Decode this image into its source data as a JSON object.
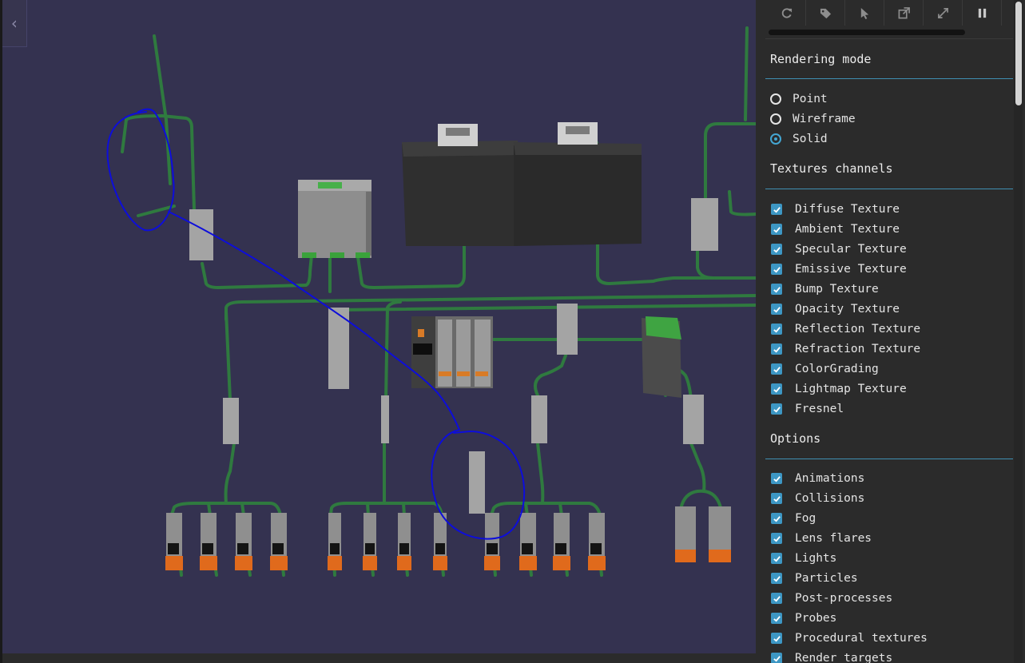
{
  "panel": {
    "toolbar": [
      {
        "icon": "refresh-icon"
      },
      {
        "icon": "tags-icon"
      },
      {
        "icon": "pointer-icon"
      },
      {
        "icon": "external-link-icon"
      },
      {
        "icon": "expand-icon"
      },
      {
        "icon": "pause-icon"
      }
    ],
    "rendering_mode": {
      "title": "Rendering mode",
      "options": [
        "Point",
        "Wireframe",
        "Solid"
      ],
      "selected": "Solid"
    },
    "textures": {
      "title": "Textures channels",
      "items": [
        "Diffuse Texture",
        "Ambient Texture",
        "Specular Texture",
        "Emissive Texture",
        "Bump Texture",
        "Opacity Texture",
        "Reflection Texture",
        "Refraction Texture",
        "ColorGrading",
        "Lightmap Texture",
        "Fresnel"
      ]
    },
    "options": {
      "title": "Options",
      "items": [
        "Animations",
        "Collisions",
        "Fog",
        "Lens flares",
        "Lights",
        "Particles",
        "Post-processes",
        "Probes",
        "Procedural textures",
        "Render targets"
      ]
    }
  },
  "viewport": {
    "collapse_icon": "chevron-left-icon"
  },
  "colors": {
    "viewport_bg": "#343250",
    "panel_bg": "#2b2b2b",
    "accent": "#3d97c4",
    "cable": "#2f7a3f",
    "annotation": "#0d0ddb"
  }
}
